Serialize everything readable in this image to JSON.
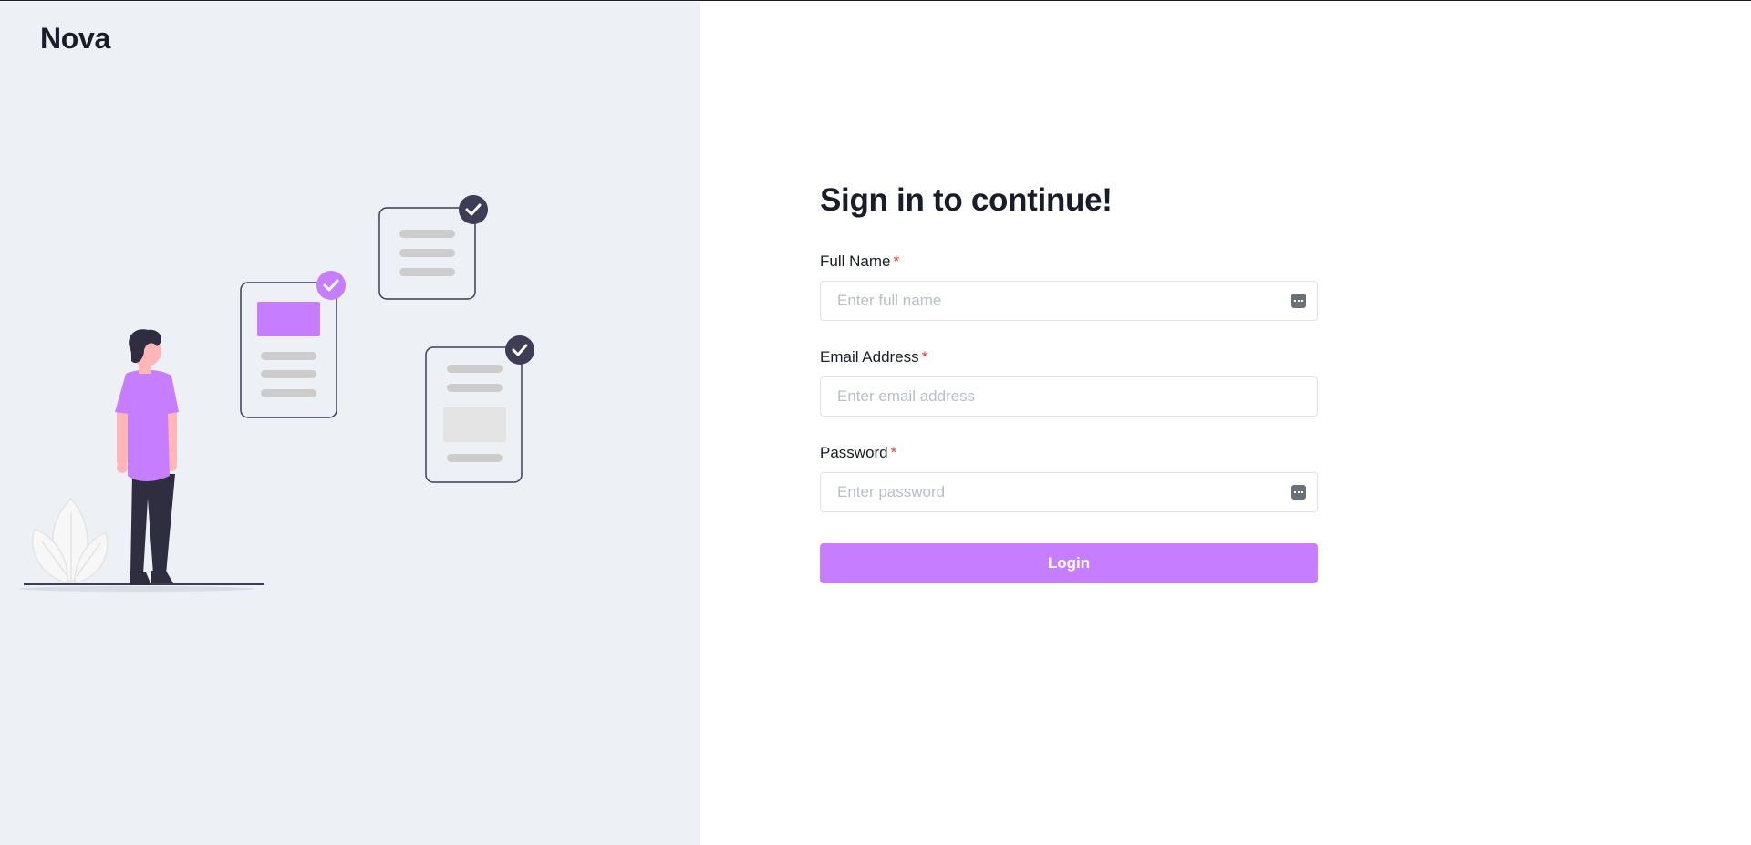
{
  "brand": {
    "name": "Nova"
  },
  "illustration": {
    "icon": "person-checklist-illustration"
  },
  "form": {
    "title": "Sign in to continue!",
    "required_mark": "*",
    "fields": {
      "full_name": {
        "label": "Full Name",
        "placeholder": "Enter full name",
        "value": ""
      },
      "email": {
        "label": "Email Address",
        "placeholder": "Enter email address",
        "value": ""
      },
      "password": {
        "label": "Password",
        "placeholder": "Enter password",
        "value": ""
      }
    },
    "submit_label": "Login"
  },
  "colors": {
    "accent": "#c77dff",
    "left_panel_bg": "#edf1f5",
    "required": "#e53935",
    "text": "#1a1d29"
  }
}
